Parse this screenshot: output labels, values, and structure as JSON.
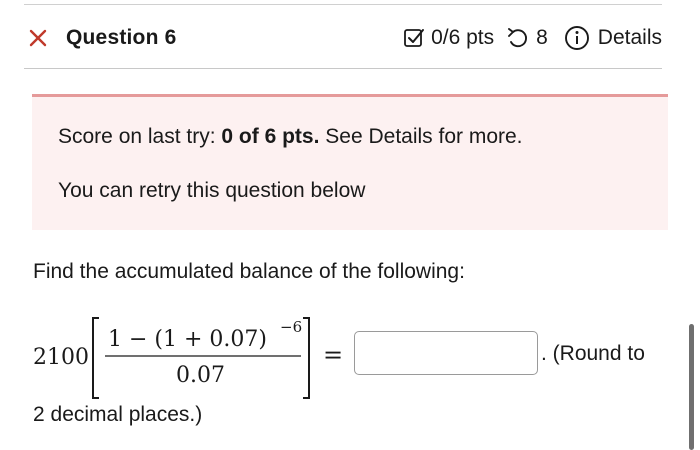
{
  "header": {
    "close_icon": "close-x-icon",
    "title": "Question 6",
    "score_icon": "checkbox-check-icon",
    "score": "0/6 pts",
    "retry_icon": "undo-arrow-icon",
    "tries": "8",
    "details_icon": "info-circle-icon",
    "details": "Details"
  },
  "feedback": {
    "prefix": "Score on last try: ",
    "score_bold": "0 of 6 pts.",
    "suffix": " See Details for more.",
    "retry_message": "You can retry this question below"
  },
  "question": {
    "prompt": "Find the accumulated balance of the following:",
    "coefficient": "2100",
    "numerator_text": "1 − (1 + 0.07)",
    "exponent": "−6",
    "denominator": "0.07",
    "equals": "=",
    "answer_value": "",
    "round_note_part1": ". (Round to",
    "round_note_part2": "2 decimal places.)"
  },
  "colors": {
    "feedback_bg": "#fdf1f1",
    "feedback_border": "#e59a9a",
    "close_icon": "#c0392b"
  }
}
